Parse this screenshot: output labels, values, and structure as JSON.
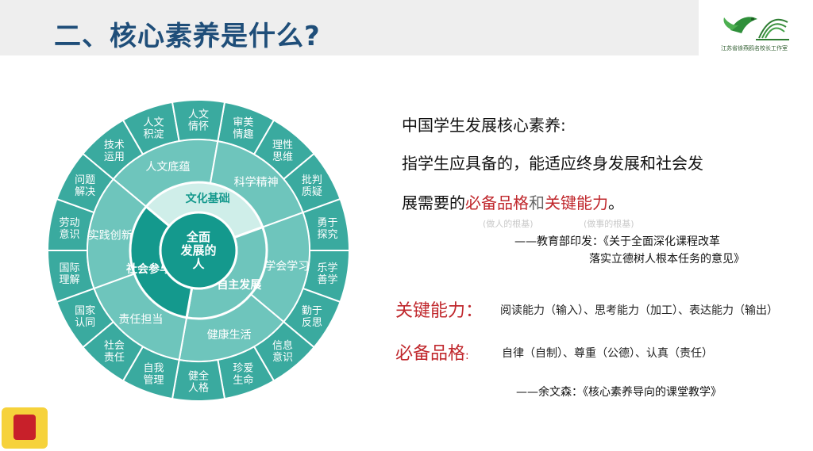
{
  "header": {
    "title": "二、核心素养是什么?",
    "logo_text": "江苏省徐燕鸥名校长工作室"
  },
  "diagram": {
    "center": [
      "全面",
      "发展的",
      "人"
    ],
    "foundations": [
      "文化基础",
      "自主发展",
      "社会参与"
    ],
    "qualities": [
      "人文底蕴",
      "科学精神",
      "学会学习",
      "健康生活",
      "责任担当",
      "实践创新"
    ],
    "points": [
      [
        "审美",
        "情趣"
      ],
      [
        "理性",
        "思维"
      ],
      [
        "批判",
        "质疑"
      ],
      [
        "勇于",
        "探究"
      ],
      [
        "乐学",
        "善学"
      ],
      [
        "勤于",
        "反思"
      ],
      [
        "信息",
        "意识"
      ],
      [
        "珍爱",
        "生命"
      ],
      [
        "健全",
        "人格"
      ],
      [
        "自我",
        "管理"
      ],
      [
        "社会",
        "责任"
      ],
      [
        "国家",
        "认同"
      ],
      [
        "国际",
        "理解"
      ],
      [
        "劳动",
        "意识"
      ],
      [
        "问题",
        "解决"
      ],
      [
        "技术",
        "运用"
      ],
      [
        "人文",
        "积淀"
      ],
      [
        "人文",
        "情怀"
      ]
    ]
  },
  "definition": {
    "heading": "中国学生发展核心素养:",
    "line1": "指学生应具备的，能适应终身发展和社会发",
    "line2_prefix": "展需要的",
    "term1": "必备品格",
    "conj": "和",
    "term2": "关键能力",
    "end": "。",
    "note1": "(做人的根基)",
    "note2": "(做事的根基)",
    "source_line1": "——教育部印发：《关于全面深化课程改革",
    "source_line2": "落实立德树人根本任务的意见》"
  },
  "key_ability": {
    "label": "关键能力：",
    "value": "阅读能力（输入）、思考能力（加工）、表达能力（输出）"
  },
  "essential_character": {
    "label": "必备品格",
    "colon": ":",
    "value": "自律（自制）、尊重（公德）、认真（责任）"
  },
  "quote_source": "——余文森：《核心素养导向的课堂教学》",
  "colors": {
    "title": "#1f4e79",
    "accent_red": "#c0282d",
    "outer_ring": "#3aaa9f",
    "mid_ring": "#6ec5bc",
    "inner_ring": "#cfeee9",
    "core": "#14998d"
  }
}
